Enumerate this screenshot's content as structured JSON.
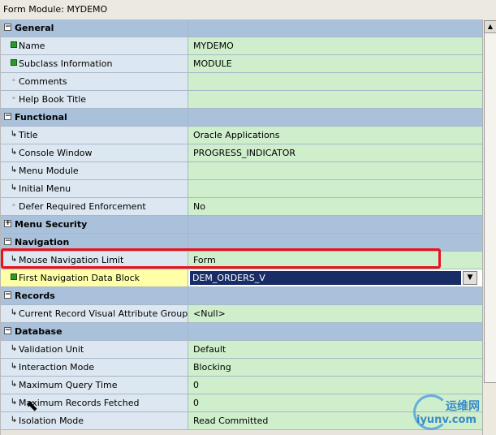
{
  "window_title": "Form Module: MYDEMO",
  "rows": [
    {
      "type": "category",
      "label": "General",
      "expander": "−",
      "value": ""
    },
    {
      "type": "property",
      "label": "Name",
      "icon": "square",
      "value": "MYDEMO"
    },
    {
      "type": "property",
      "label": "Subclass Information",
      "icon": "square",
      "value": "MODULE"
    },
    {
      "type": "property",
      "label": "Comments",
      "icon": "dot",
      "value": ""
    },
    {
      "type": "property",
      "label": "Help Book Title",
      "icon": "dot",
      "value": ""
    },
    {
      "type": "category",
      "label": "Functional",
      "expander": "−",
      "value": ""
    },
    {
      "type": "property",
      "label": "Title",
      "icon": "arrow",
      "value": "Oracle Applications"
    },
    {
      "type": "property",
      "label": "Console Window",
      "icon": "arrow",
      "value": "PROGRESS_INDICATOR"
    },
    {
      "type": "property",
      "label": "Menu Module",
      "icon": "arrow",
      "value": ""
    },
    {
      "type": "property",
      "label": "Initial Menu",
      "icon": "arrow",
      "value": ""
    },
    {
      "type": "property",
      "label": "Defer Required Enforcement",
      "icon": "dot",
      "value": "No"
    },
    {
      "type": "category",
      "label": "Menu Security",
      "expander": "+",
      "value": ""
    },
    {
      "type": "category",
      "label": "Navigation",
      "expander": "−",
      "value": ""
    },
    {
      "type": "property",
      "label": "Mouse Navigation Limit",
      "icon": "arrow",
      "value": "Form"
    },
    {
      "type": "property",
      "label": "First Navigation Data Block",
      "icon": "square",
      "value": "DEM_ORDERS_V",
      "selected": true
    },
    {
      "type": "category",
      "label": "Records",
      "expander": "−",
      "value": ""
    },
    {
      "type": "property",
      "label": "Current Record Visual Attribute Group",
      "icon": "arrow",
      "value": "<Null>"
    },
    {
      "type": "category",
      "label": "Database",
      "expander": "−",
      "value": ""
    },
    {
      "type": "property",
      "label": "Validation Unit",
      "icon": "arrow",
      "value": "Default"
    },
    {
      "type": "property",
      "label": "Interaction Mode",
      "icon": "arrow",
      "value": "Blocking"
    },
    {
      "type": "property",
      "label": "Maximum Query Time",
      "icon": "arrow",
      "value": "0"
    },
    {
      "type": "property",
      "label": "Maximum Records Fetched",
      "icon": "arrow",
      "value": "0"
    },
    {
      "type": "property",
      "label": "Isolation Mode",
      "icon": "arrow",
      "value": "Read Committed"
    }
  ],
  "combo_arrow": "▼",
  "watermark": {
    "text_cn": "运维网",
    "url": "iyunv.com"
  },
  "colors": {
    "category": "#a9c1da",
    "label_bg": "#dce7f2",
    "value_bg": "#cfeecb",
    "selection": "#182c66",
    "highlight_border": "#e8121b"
  }
}
